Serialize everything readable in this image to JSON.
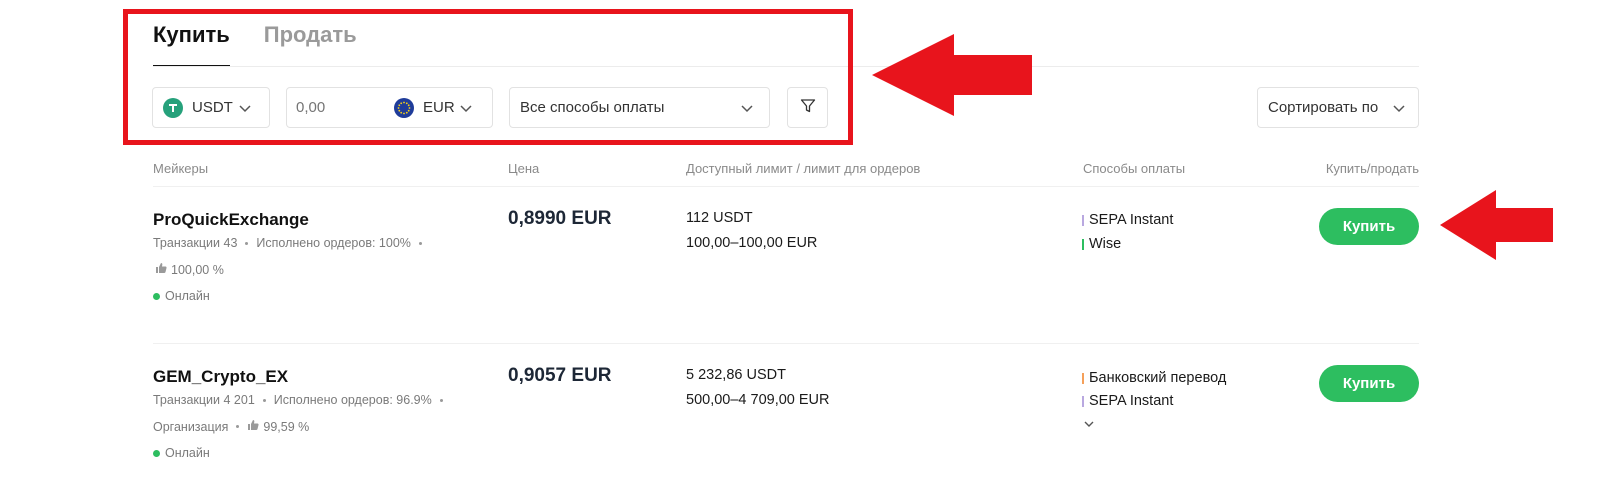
{
  "tabs": [
    {
      "label": "Купить",
      "active": true
    },
    {
      "label": "Продать",
      "active": false
    }
  ],
  "filters": {
    "crypto": {
      "value": "USDT",
      "icon": "tether-icon"
    },
    "amount": {
      "placeholder": "0,00",
      "currency": "EUR",
      "icon": "euro-icon"
    },
    "payment": {
      "value": "Все способы оплаты"
    },
    "filter_icon": "filter-icon",
    "sort": {
      "label": "Сортировать по"
    }
  },
  "columns": {
    "makers": "Мейкеры",
    "price": "Цена",
    "limit": "Доступный лимит / лимит для ордеров",
    "payment": "Способы оплаты",
    "action": "Купить/продать"
  },
  "offers": [
    {
      "name": "ProQuickExchange",
      "transactions": "Транзакции 43",
      "completed": "Исполнено ордеров: 100%",
      "rating": "100,00 %",
      "online": "Онлайн",
      "price": "0,8990 EUR",
      "available": "112 USDT",
      "order_limit": "100,00–100,00 EUR",
      "payments": [
        {
          "label": "SEPA Instant",
          "color": "#b9a8e0"
        },
        {
          "label": "Wise",
          "color": "#2dbe60"
        }
      ],
      "button": "Купить"
    },
    {
      "name": "GEM_Crypto_EX",
      "transactions": "Транзакции 4 201",
      "completed": "Исполнено ордеров: 96.9%",
      "organization": "Организация",
      "rating": "99,59 %",
      "online": "Онлайн",
      "price": "0,9057 EUR",
      "available": "5 232,86 USDT",
      "order_limit": "500,00–4 709,00 EUR",
      "payments": [
        {
          "label": "Банковский перевод",
          "color": "#f5a05a"
        },
        {
          "label": "SEPA Instant",
          "color": "#b9a8e0"
        }
      ],
      "button": "Купить"
    }
  ],
  "colors": {
    "accent_green": "#2dbe60",
    "annotation_red": "#e8141c"
  }
}
